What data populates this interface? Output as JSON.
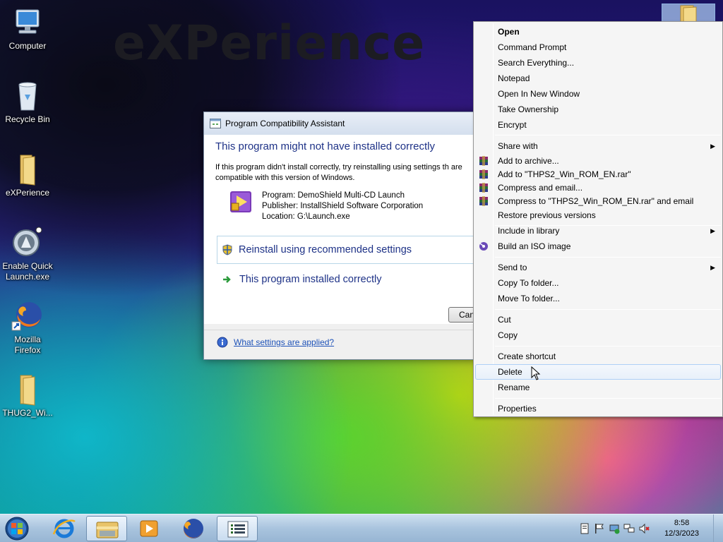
{
  "wallpaper": {
    "brand_text": "eXPerience"
  },
  "desktop_icons": [
    {
      "label": "Computer",
      "icon": "computer-icon"
    },
    {
      "label": "Recycle Bin",
      "icon": "recycle-bin-icon"
    },
    {
      "label": "eXPerience",
      "icon": "folder-icon"
    },
    {
      "label": "Enable Quick Launch.exe",
      "icon": "quick-launch-icon"
    },
    {
      "label": "Mozilla Firefox",
      "icon": "firefox-icon"
    },
    {
      "label": "THUG2_Wi...",
      "icon": "folder-icon"
    }
  ],
  "dialog": {
    "title": "Program Compatibility Assistant",
    "headline": "This program might not have installed correctly",
    "paragraph": "If this program didn't install correctly, try reinstalling using settings th are compatible with this version of Windows.",
    "program": "Program: DemoShield Multi-CD Launch",
    "publisher": "Publisher: InstallShield Software Corporation",
    "location": "Location: G:\\Launch.exe",
    "option_reinstall": "Reinstall using recommended settings",
    "option_installed_correctly": "This program installed correctly",
    "cancel_label": "Can",
    "help_link": "What settings are applied?"
  },
  "context_menu": {
    "items": [
      {
        "label": "Open",
        "bold": true
      },
      {
        "label": "Command Prompt"
      },
      {
        "label": "Search Everything..."
      },
      {
        "label": "Notepad"
      },
      {
        "label": "Open In New Window"
      },
      {
        "label": "Take Ownership"
      },
      {
        "label": "Encrypt"
      },
      {
        "label": "Share with",
        "submenu": true
      },
      {
        "label": "Add to archive...",
        "icon": "winrar-icon"
      },
      {
        "label": "Add to \"THPS2_Win_ROM_EN.rar\"",
        "icon": "winrar-icon"
      },
      {
        "label": "Compress and email...",
        "icon": "winrar-icon"
      },
      {
        "label": "Compress to \"THPS2_Win_ROM_EN.rar\" and email",
        "icon": "winrar-icon"
      },
      {
        "label": "Restore previous versions"
      },
      {
        "label": "Include in library",
        "submenu": true
      },
      {
        "label": "Build an ISO image",
        "icon": "iso-icon"
      },
      {
        "label": "Send to",
        "submenu": true
      },
      {
        "label": "Copy To folder..."
      },
      {
        "label": "Move To folder..."
      },
      {
        "label": "Cut"
      },
      {
        "label": "Copy"
      },
      {
        "label": "Create shortcut"
      },
      {
        "label": "Delete",
        "highlighted": true
      },
      {
        "label": "Rename"
      },
      {
        "label": "Properties"
      }
    ]
  },
  "taskbar": {
    "start": "start-orb-icon",
    "pinned": [
      "internet-explorer-icon",
      "file-explorer-icon",
      "media-player-icon",
      "firefox-icon",
      "compatibility-assistant-icon"
    ],
    "tray_icons": [
      "action-center-icon",
      "flag-icon",
      "network-icon",
      "display-icon",
      "volume-muted-icon"
    ],
    "time": "8:58",
    "date": "12/3/2023"
  },
  "colors": {
    "headline": "#1e3287",
    "link": "#1e52b8",
    "menu_highlight_border": "#aecff7"
  }
}
